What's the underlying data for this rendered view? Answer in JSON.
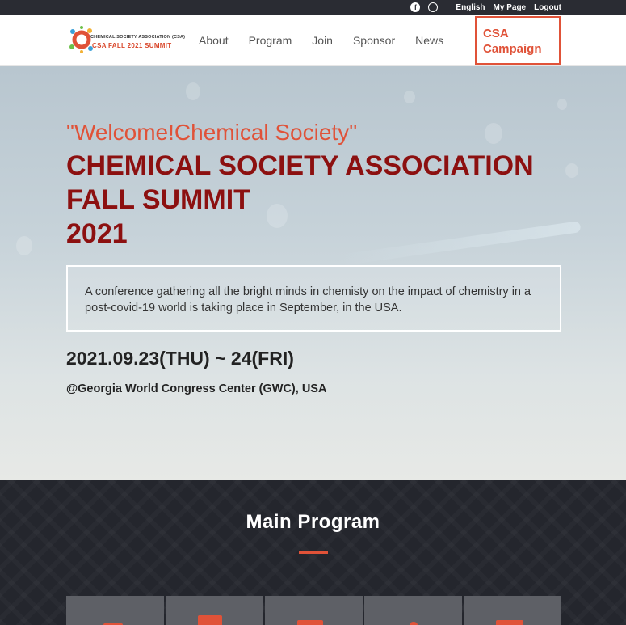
{
  "topbar": {
    "facebook_icon": "f",
    "other_icon": "o",
    "lang": "English",
    "mypage": "My Page",
    "logout": "Logout"
  },
  "header": {
    "logo_line1": "CHEMICAL SOCIETY ASSOCIATION (CSA)",
    "logo_line2": "CSA FALL 2021 SUMMIT",
    "menu": [
      "About",
      "Program",
      "Join",
      "Sponsor",
      "News"
    ],
    "campaign_label": "CSA Campaign"
  },
  "hero": {
    "welcome": "\"Welcome!Chemical Society\"",
    "title_line1": "CHEMICAL SOCIETY ASSOCIATION",
    "title_line2": "FALL SUMMIT",
    "title_line3": "2021",
    "description": "A conference gathering all the bright minds in chemisty on the impact of chemistry in a post-covid-19 world is taking place in September, in the USA.",
    "date": "2021.09.23(THU) ~ 24(FRI)",
    "venue": "@Georgia World Congress Center (GWC), USA"
  },
  "program": {
    "heading": "Main Program"
  },
  "colors": {
    "accent": "#e05238",
    "title": "#8c1010",
    "dark_bg": "#24262d"
  }
}
